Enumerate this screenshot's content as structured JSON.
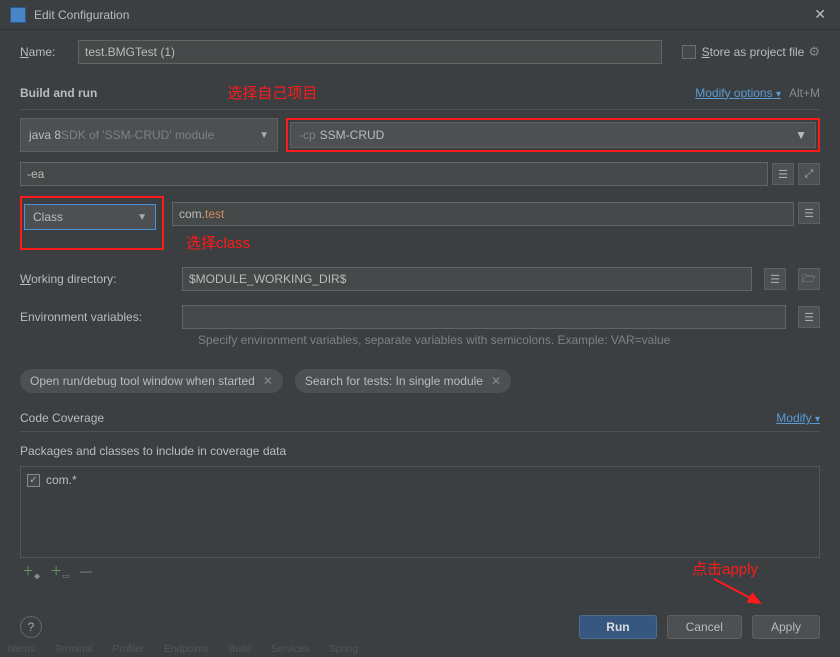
{
  "titlebar": {
    "title": "Edit Configuration"
  },
  "name": {
    "label": "Name:",
    "underline": "N",
    "value": "test.BMGTest (1)"
  },
  "store": {
    "label": "Store as project file",
    "underline": "S"
  },
  "buildrun": {
    "title": "Build and run",
    "modify": "Modify options",
    "shortcut": "Alt+M",
    "annot1": "选择自己项目",
    "sdk_a": "java 8",
    "sdk_b": " SDK of 'SSM-CRUD' module",
    "cp_a": "-cp",
    "cp_b": "SSM-CRUD",
    "ea": "-ea",
    "class_label": "Class",
    "class_annot": "选择class",
    "class_pkg": "com.",
    "class_name": "test",
    "wd_label": "Working directory:",
    "wd_underline": "W",
    "wd_value": "$MODULE_WORKING_DIR$",
    "env_label": "Environment variables:",
    "env_help": "Specify environment variables, separate variables with semicolons. Example: VAR=value",
    "pill1": "Open run/debug tool window when started",
    "pill2": "Search for tests: In single module"
  },
  "coverage": {
    "title": "Code Coverage",
    "modify": "Modify",
    "pkg_label": "Packages and classes to include in coverage data",
    "item": "com.*"
  },
  "annot_apply": "点击apply",
  "footer": {
    "run": "Run",
    "cancel": "Cancel",
    "apply": "Apply"
  },
  "bottom_tabs": [
    "blems",
    "Terminal",
    "Profiler",
    "Endpoints",
    "Build",
    "Services",
    "Spring"
  ]
}
